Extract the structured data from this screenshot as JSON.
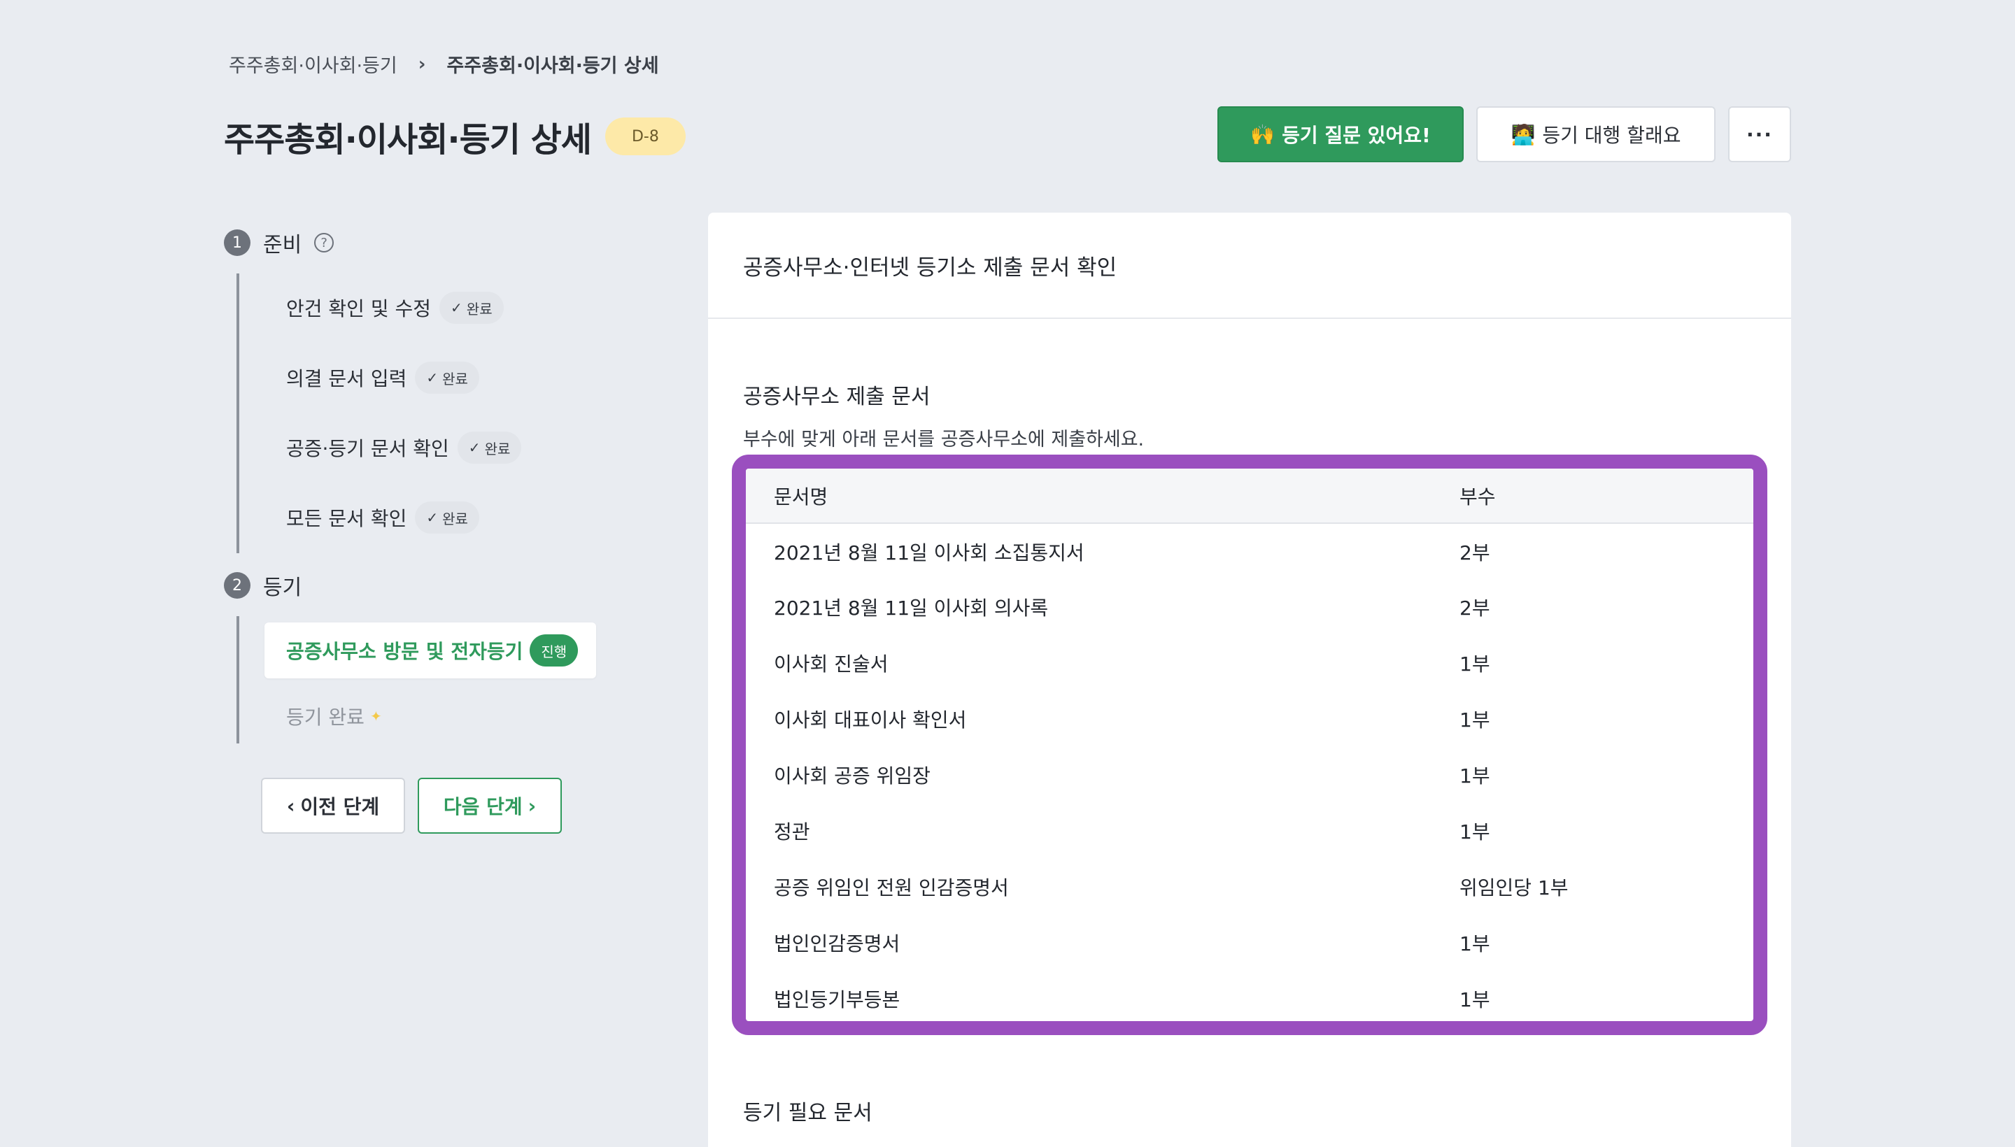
{
  "breadcrumb": {
    "parent": "주주총회·이사회·등기",
    "separator": "›",
    "current": "주주총회·이사회·등기 상세"
  },
  "title": "주주총회·이사회·등기 상세",
  "dday": "D-8",
  "header_actions": {
    "ask_icon": "🙌",
    "ask_label": "등기 질문 있어요!",
    "delegate_icon": "🧑‍💻",
    "delegate_label": "등기 대행 할래요",
    "more_label": "···"
  },
  "stepper": {
    "steps": [
      {
        "number": "1",
        "label": "준비",
        "help": "?",
        "items": [
          {
            "label": "안건 확인 및 수정",
            "status": "완료"
          },
          {
            "label": "의결 문서 입력",
            "status": "완료"
          },
          {
            "label": "공증·등기 문서 확인",
            "status": "완료"
          },
          {
            "label": "모든 문서 확인",
            "status": "완료"
          }
        ]
      },
      {
        "number": "2",
        "label": "등기",
        "active_item": {
          "label": "공증사무소 방문 및 전자등기",
          "status": "진행"
        },
        "pending_item": {
          "label": "등기 완료",
          "icon": "✦"
        }
      }
    ],
    "check_icon": "✓",
    "prev_label": "이전 단계",
    "next_label": "다음 단계",
    "prev_icon": "‹",
    "next_icon": "›"
  },
  "panel": {
    "header": "공증사무소·인터넷 등기소 제출 문서 확인",
    "notary_section": {
      "title": "공증사무소 제출 문서",
      "description": "부수에 맞게 아래 문서를 공증사무소에 제출하세요.",
      "columns": [
        "문서명",
        "부수"
      ],
      "rows": [
        {
          "name": "2021년 8월 11일 이사회 소집통지서",
          "copies": "2부"
        },
        {
          "name": "2021년 8월 11일 이사회 의사록",
          "copies": "2부"
        },
        {
          "name": "이사회 진술서",
          "copies": "1부"
        },
        {
          "name": "이사회 대표이사 확인서",
          "copies": "1부"
        },
        {
          "name": "이사회 공증 위임장",
          "copies": "1부"
        },
        {
          "name": "정관",
          "copies": "1부"
        },
        {
          "name": "공증 위임인 전원 인감증명서",
          "copies": "위임인당 1부"
        },
        {
          "name": "법인인감증명서",
          "copies": "1부"
        },
        {
          "name": "법인등기부등본",
          "copies": "1부"
        }
      ]
    },
    "registry_section": {
      "title": "등기 필요 문서"
    }
  },
  "colors": {
    "brand_green": "#2f9a5c",
    "highlight_purple": "#9a4fbf",
    "dday_bg": "#fde9a8",
    "page_bg": "#e9ecf1"
  }
}
